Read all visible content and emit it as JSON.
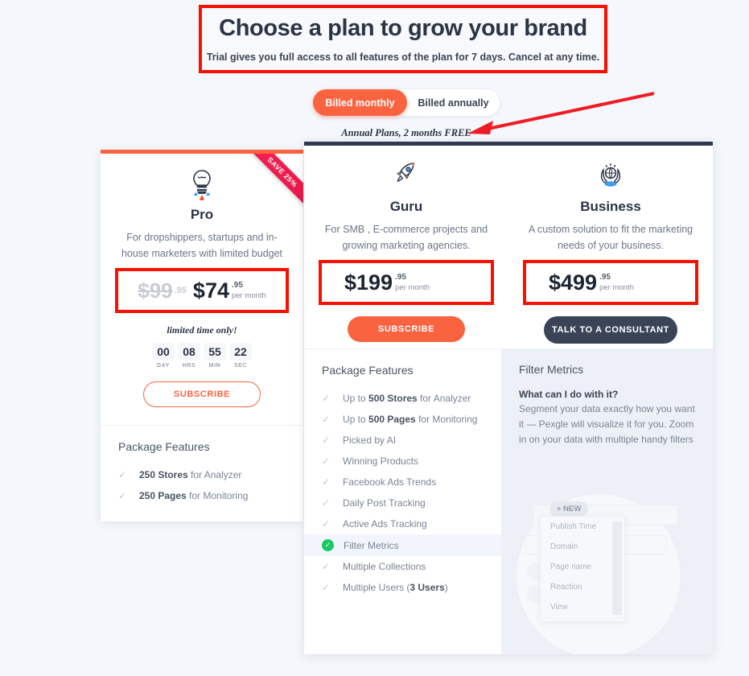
{
  "header": {
    "title": "Choose a plan to grow your brand",
    "subtitle": "Trial gives you full access to all features of the plan for 7 days. Cancel at any time."
  },
  "billing_toggle": {
    "monthly_label": "Billed monthly",
    "annually_label": "Billed annually",
    "selected": "Billed monthly",
    "note": "Annual Plans, 2 months FREE",
    "active_color": "#fa6340"
  },
  "plans": {
    "pro": {
      "ribbon": "SAVE 25%",
      "icon": "lightbulb-rocket-icon",
      "name": "Pro",
      "description": "For dropshippers, startups and in-house marketers with limited budget",
      "old_price": "$99",
      "old_cents": ".95",
      "price": "$74",
      "cents": ".95",
      "period": "per month",
      "limited_note": "limited time only!",
      "countdown": [
        {
          "value": "00",
          "label": "DAY"
        },
        {
          "value": "08",
          "label": "HRS"
        },
        {
          "value": "55",
          "label": "MIN"
        },
        {
          "value": "22",
          "label": "SEC"
        }
      ],
      "cta": "SUBSCRIBE",
      "features_title": "Package Features",
      "features": [
        {
          "bold": "250 Stores",
          "rest": " for Analyzer",
          "highlighted": false
        },
        {
          "bold": "250 Pages",
          "rest": " for Monitoring",
          "highlighted": false
        }
      ]
    },
    "guru": {
      "icon": "rocket-icon",
      "name": "Guru",
      "description": "For SMB , E-commerce projects and growing marketing agencies.",
      "price": "$199",
      "cents": ".95",
      "period": "per month",
      "cta": "SUBSCRIBE",
      "features_title": "Package Features",
      "features": [
        {
          "pre": "Up to ",
          "bold": "500 Stores",
          "rest": " for Analyzer",
          "highlighted": false
        },
        {
          "pre": "Up to ",
          "bold": "500 Pages",
          "rest": " for Monitoring",
          "highlighted": false
        },
        {
          "pre": "Picked by AI",
          "bold": "",
          "rest": "",
          "highlighted": false
        },
        {
          "pre": "Winning Products",
          "bold": "",
          "rest": "",
          "highlighted": false
        },
        {
          "pre": "Facebook Ads Trends",
          "bold": "",
          "rest": "",
          "highlighted": false
        },
        {
          "pre": "Daily Post Tracking",
          "bold": "",
          "rest": "",
          "highlighted": false
        },
        {
          "pre": "Active Ads Tracking",
          "bold": "",
          "rest": "",
          "highlighted": false
        },
        {
          "pre": "Filter Metrics",
          "bold": "",
          "rest": "",
          "highlighted": true
        },
        {
          "pre": "Multiple Collections",
          "bold": "",
          "rest": "",
          "highlighted": false
        },
        {
          "pre": "Multiple Users (",
          "bold": "3 Users",
          "rest": ")",
          "highlighted": false
        }
      ]
    },
    "business": {
      "icon": "hands-globe-icon",
      "name": "Business",
      "description": "A custom solution to fit the marketing needs of your business.",
      "price": "$499",
      "cents": ".95",
      "period": "per month",
      "cta": "TALK TO A CONSULTANT"
    }
  },
  "info_panel": {
    "title": "Filter Metrics",
    "question": "What can I do with it?",
    "body": "Segment your data exactly how you want it — Pexgle will visualize it for you. Zoom in on your data with multiple handy filters",
    "illustration": {
      "new_label": "+ NEW",
      "dropdown_items": [
        "Publish Time",
        "Domain",
        "Page name",
        "Reaction",
        "View"
      ]
    }
  },
  "annotations": {
    "arrow_color": "#ee1c25",
    "box_color": "#f81000"
  }
}
